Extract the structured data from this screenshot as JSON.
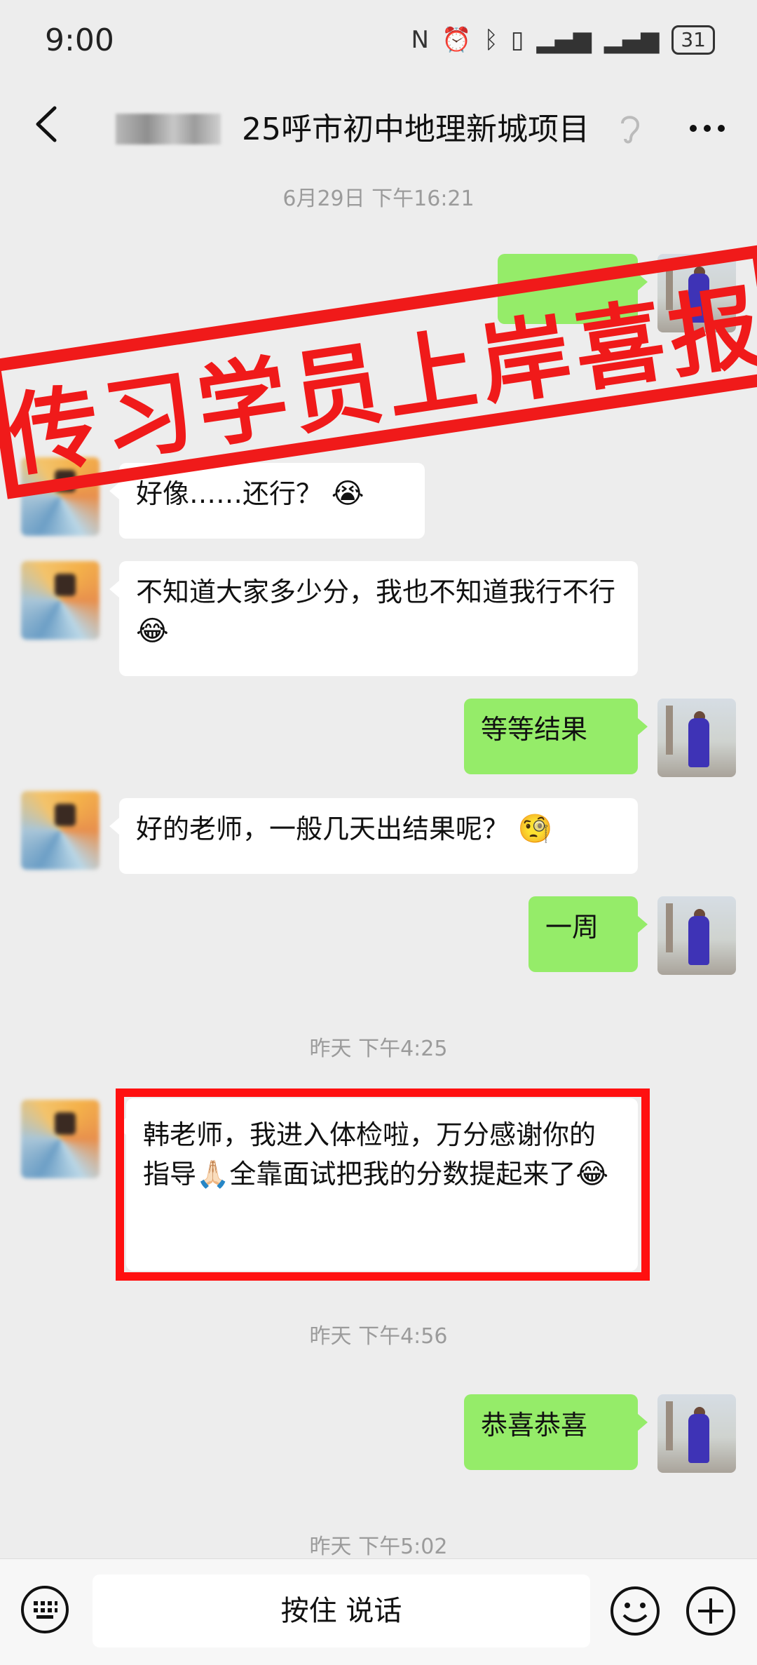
{
  "status_bar": {
    "time": "9:00",
    "battery": "31"
  },
  "header": {
    "title": "25呼市初中地理新城项目"
  },
  "chat": {
    "timestamps": [
      "6月29日 下午16:21",
      "昨天 下午4:25",
      "昨天 下午4:56",
      "昨天 下午5:02"
    ],
    "messages": [
      {
        "side": "left",
        "text": "好像……还行？"
      },
      {
        "side": "left",
        "text": "不知道大家多少分，我也不知道我行不行"
      },
      {
        "side": "right",
        "text": "等等结果"
      },
      {
        "side": "left",
        "text": "好的老师，一般几天出结果呢？"
      },
      {
        "side": "right",
        "text": "一周"
      },
      {
        "side": "left",
        "text": "韩老师，我进入体检啦，万分感谢你的指导🙏🏻全靠面试把我的分数提起来了"
      },
      {
        "side": "right",
        "text": "恭喜恭喜"
      }
    ]
  },
  "stamp": {
    "text": "传习学员上岸喜报"
  },
  "input_bar": {
    "voice_label": "按住 说话"
  },
  "colors": {
    "accent_red": "#f01a1a",
    "bubble_green": "#95ec69",
    "background": "#ededed"
  },
  "icons": [
    "back-arrow-icon",
    "ear-icon",
    "more-dots-icon",
    "keyboard-icon",
    "emoji-icon",
    "plus-icon"
  ]
}
